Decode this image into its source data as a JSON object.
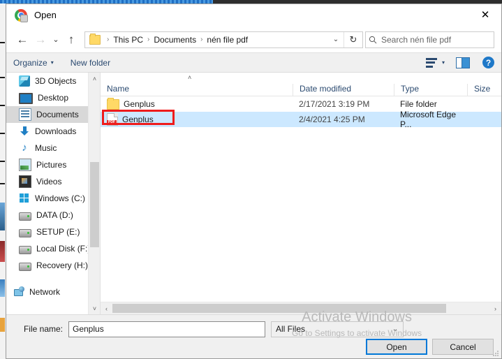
{
  "window": {
    "title": "Open",
    "app_icon": "chrome-icon",
    "close_label": "✕"
  },
  "nav": {
    "back": "←",
    "forward": "→",
    "recent": "⌄",
    "up": "↑"
  },
  "address": {
    "folder_icon": "folder-icon",
    "crumbs": [
      "This PC",
      "Documents",
      "nén file pdf"
    ],
    "separator": "›",
    "dropdown": "⌄",
    "refresh": "↻"
  },
  "search": {
    "placeholder": "Search nén file pdf",
    "value": "",
    "icon": "search-icon"
  },
  "toolbar": {
    "organize": "Organize",
    "organize_caret": "▾",
    "new_folder": "New folder",
    "view_caret": "▾",
    "help": "?"
  },
  "sidebar": {
    "items": [
      {
        "label": "3D Objects",
        "icon": "cube-icon",
        "selected": false
      },
      {
        "label": "Desktop",
        "icon": "desktop-icon",
        "selected": false
      },
      {
        "label": "Documents",
        "icon": "document-icon",
        "selected": true
      },
      {
        "label": "Downloads",
        "icon": "download-icon",
        "selected": false
      },
      {
        "label": "Music",
        "icon": "music-icon",
        "selected": false
      },
      {
        "label": "Pictures",
        "icon": "picture-icon",
        "selected": false
      },
      {
        "label": "Videos",
        "icon": "video-icon",
        "selected": false
      },
      {
        "label": "Windows (C:)",
        "icon": "windows-icon",
        "selected": false
      },
      {
        "label": "DATA (D:)",
        "icon": "drive-icon",
        "selected": false
      },
      {
        "label": "SETUP (E:)",
        "icon": "drive-icon",
        "selected": false
      },
      {
        "label": "Local Disk (F:)",
        "icon": "drive-icon",
        "selected": false
      },
      {
        "label": "Recovery (H:)",
        "icon": "drive-icon",
        "selected": false
      },
      {
        "label": "Network",
        "icon": "network-icon",
        "selected": false
      }
    ],
    "scroll_up": "˄",
    "scroll_down": "˅"
  },
  "filelist": {
    "sort_indicator": "˄",
    "columns": [
      "Name",
      "Date modified",
      "Type",
      "Size"
    ],
    "rows": [
      {
        "name": "Genplus",
        "icon": "folder-icon",
        "date_modified": "2/17/2021 3:19 PM",
        "type": "File folder",
        "size": "",
        "selected": false,
        "annotated": false
      },
      {
        "name": "Genplus",
        "icon": "pdf-icon",
        "icon_label": "PDF",
        "date_modified": "2/4/2021 4:25 PM",
        "type": "Microsoft Edge P...",
        "size": "",
        "selected": true,
        "annotated": true
      }
    ],
    "hscroll_left": "‹",
    "hscroll_right": "›"
  },
  "footer": {
    "filename_label": "File name:",
    "filename_value": "Genplus",
    "filter_value": "All Files",
    "filter_caret": "⌄",
    "open_label": "Open",
    "cancel_label": "Cancel"
  },
  "watermark": {
    "title": "Activate Windows",
    "subtitle": "Go to Settings to activate Windows"
  },
  "colors": {
    "accent": "#0078d7",
    "selection": "#cce8ff",
    "annotation": "#ef1c1c",
    "link_text": "#2b4a70"
  }
}
